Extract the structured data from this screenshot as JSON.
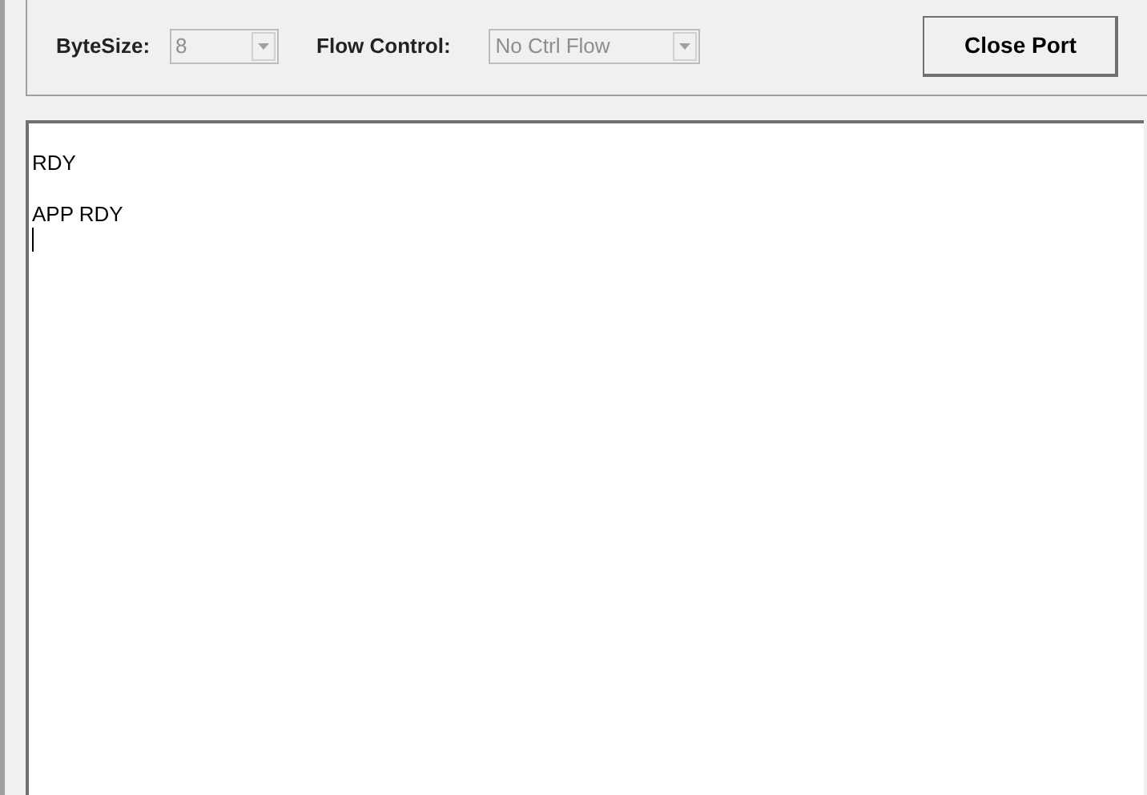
{
  "settings": {
    "fields": [
      {
        "label": "ByteSize:",
        "value": "8",
        "disabled": true
      },
      {
        "label": "Flow Control:",
        "value": "No Ctrl Flow",
        "disabled": true
      }
    ]
  },
  "close_button": {
    "label": "Close Port"
  },
  "terminal": {
    "lines": [
      "RDY",
      "APP RDY"
    ]
  }
}
